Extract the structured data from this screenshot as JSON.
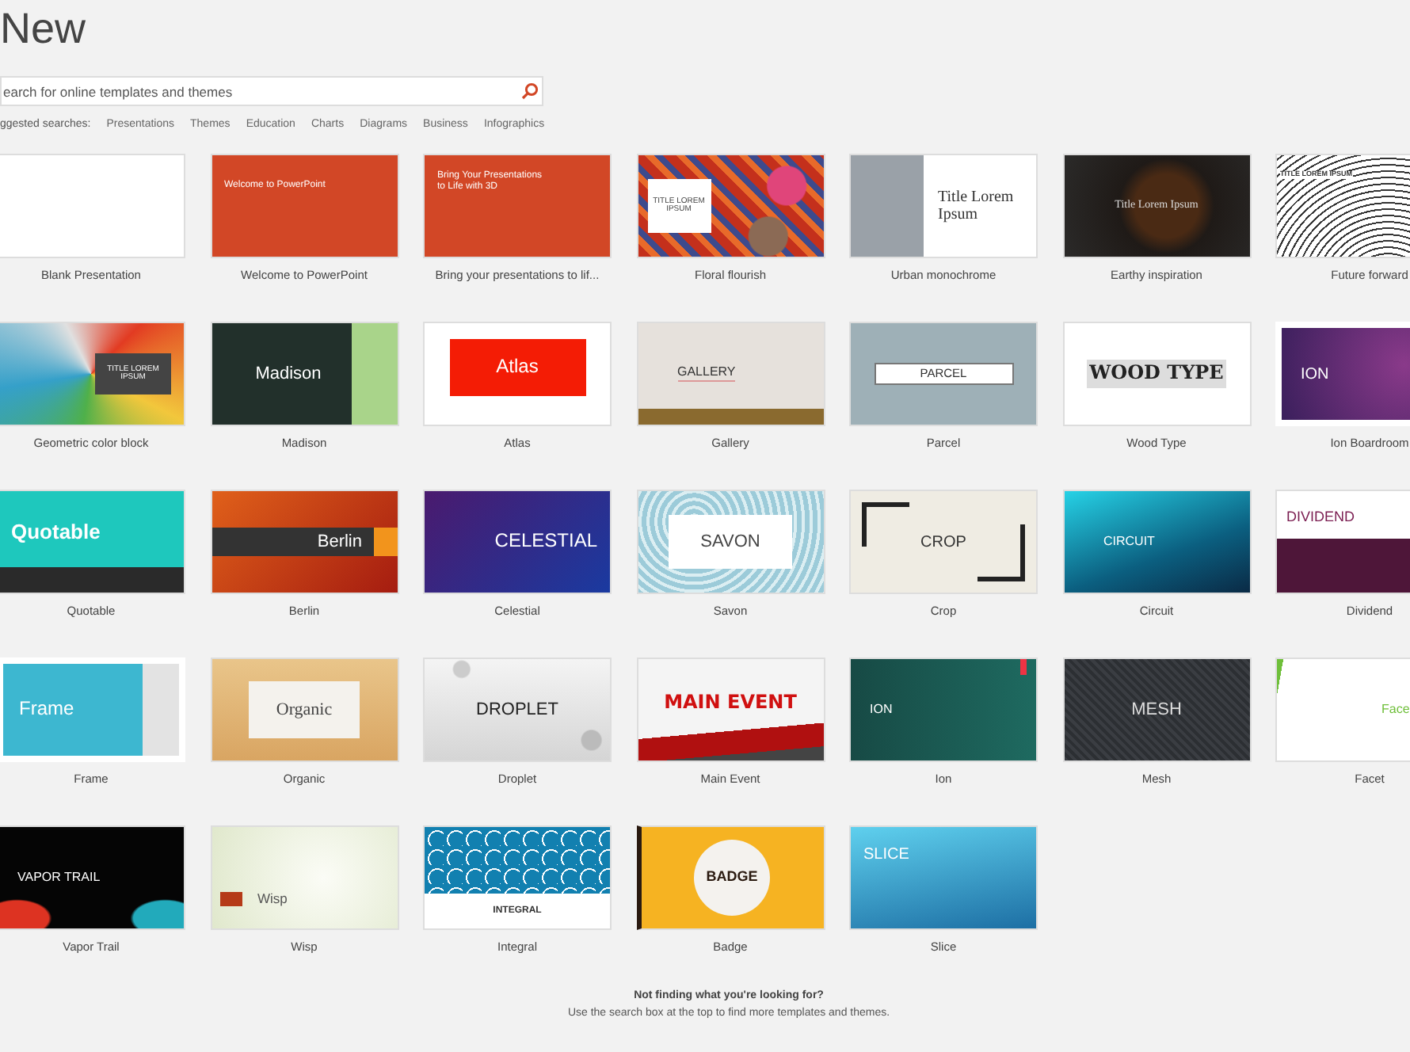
{
  "heading": "New",
  "search": {
    "placeholder": "earch for online templates and themes"
  },
  "suggested": {
    "label": "ggested searches:",
    "links": [
      "Presentations",
      "Themes",
      "Education",
      "Charts",
      "Diagrams",
      "Business",
      "Infographics"
    ]
  },
  "templates": [
    {
      "name": "Blank Presentation",
      "kind": "blank"
    },
    {
      "name": "Welcome to PowerPoint",
      "kind": "welcome",
      "slide_title": "Welcome to PowerPoint"
    },
    {
      "name": "Bring your presentations to lif...",
      "kind": "bring3d",
      "slide_title": "Bring Your Presentations to Life with 3D"
    },
    {
      "name": "Floral flourish",
      "kind": "floral",
      "slide_title": "TITLE LOREM IPSUM"
    },
    {
      "name": "Urban monochrome",
      "kind": "urban",
      "slide_title": "Title Lorem Ipsum"
    },
    {
      "name": "Earthy inspiration",
      "kind": "earthy",
      "slide_title": "Title Lorem Ipsum"
    },
    {
      "name": "Future forward",
      "kind": "future",
      "slide_title": "TITLE LOREM IPSUM"
    },
    {
      "name": "Geometric color block",
      "kind": "geometric",
      "slide_title": "TITLE LOREM IPSUM"
    },
    {
      "name": "Madison",
      "kind": "madison",
      "slide_title": "Madison"
    },
    {
      "name": "Atlas",
      "kind": "atlas",
      "slide_title": "Atlas"
    },
    {
      "name": "Gallery",
      "kind": "gallery",
      "slide_title": "GALLERY"
    },
    {
      "name": "Parcel",
      "kind": "parcel",
      "slide_title": "PARCEL"
    },
    {
      "name": "Wood Type",
      "kind": "woodtype",
      "slide_title": "WOOD TYPE"
    },
    {
      "name": "Ion Boardroom",
      "kind": "ionboard",
      "slide_title": "ION"
    },
    {
      "name": "Quotable",
      "kind": "quotable",
      "slide_title": "Quotable"
    },
    {
      "name": "Berlin",
      "kind": "berlin",
      "slide_title": "Berlin"
    },
    {
      "name": "Celestial",
      "kind": "celestial",
      "slide_title": "CELESTIAL"
    },
    {
      "name": "Savon",
      "kind": "savon",
      "slide_title": "SAVON"
    },
    {
      "name": "Crop",
      "kind": "crop",
      "slide_title": "CROP"
    },
    {
      "name": "Circuit",
      "kind": "circuit",
      "slide_title": "CIRCUIT"
    },
    {
      "name": "Dividend",
      "kind": "dividend",
      "slide_title": "DIVIDEND"
    },
    {
      "name": "Frame",
      "kind": "frame",
      "slide_title": "Frame"
    },
    {
      "name": "Organic",
      "kind": "organic",
      "slide_title": "Organic"
    },
    {
      "name": "Droplet",
      "kind": "droplet",
      "slide_title": "DROPLET"
    },
    {
      "name": "Main Event",
      "kind": "mainevent",
      "slide_title": "MAIN EVENT"
    },
    {
      "name": "Ion",
      "kind": "ion",
      "slide_title": "ION"
    },
    {
      "name": "Mesh",
      "kind": "mesh",
      "slide_title": "MESH"
    },
    {
      "name": "Facet",
      "kind": "facet",
      "slide_title": "Face"
    },
    {
      "name": "Vapor Trail",
      "kind": "vapor",
      "slide_title": "VAPOR TRAIL"
    },
    {
      "name": "Wisp",
      "kind": "wisp",
      "slide_title": "Wisp"
    },
    {
      "name": "Integral",
      "kind": "integral",
      "slide_title": "INTEGRAL"
    },
    {
      "name": "Badge",
      "kind": "badge",
      "slide_title": "BADGE"
    },
    {
      "name": "Slice",
      "kind": "slice",
      "slide_title": "SLICE"
    }
  ],
  "footer": {
    "title": "Not finding what you're looking for?",
    "text": "Use the search box at the top to find more templates and themes."
  }
}
